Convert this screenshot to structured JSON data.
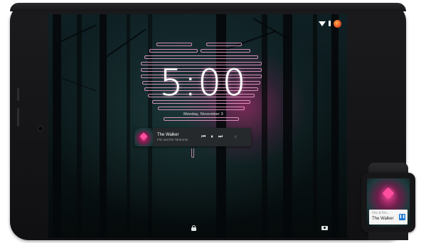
{
  "status_bar": {
    "icons": [
      "wifi-icon",
      "battery-icon",
      "user-avatar-icon"
    ]
  },
  "lockscreen": {
    "time": "5:00",
    "date": "Monday, November 3"
  },
  "media_notification": {
    "title": "The Walker",
    "artist": "Fitz and the Tantrums",
    "controls": {
      "previous": "⏮",
      "play_pause": "⏸",
      "next": "⏭",
      "dismiss": "✕"
    }
  },
  "bottom_icons": [
    "lock-icon",
    "camera-icon"
  ],
  "watch": {
    "artist": "Fitz & the...",
    "title": "The Walker",
    "pause": "❚❚"
  },
  "colors": {
    "accent_pink": "#ff4ea0",
    "screen_bg": "#0a1618",
    "card_bg": "#26292b",
    "watch_button": "#1976d2"
  }
}
